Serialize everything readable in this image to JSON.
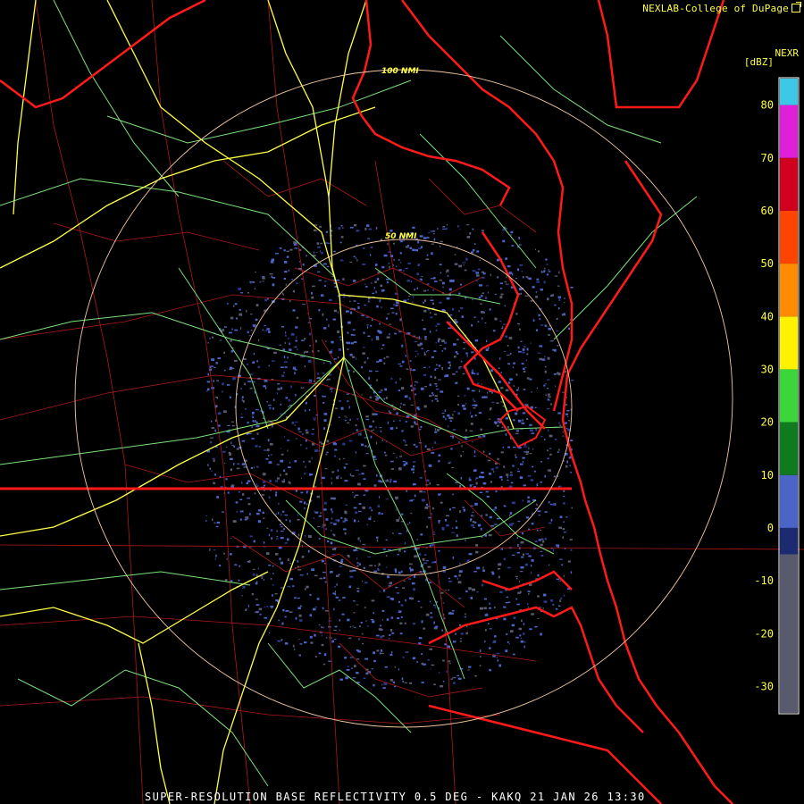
{
  "header": {
    "credit": "NEXLAB-College of DuPage",
    "product": "NEXR",
    "units": "[dBZ]"
  },
  "footer": {
    "caption": "SUPER-RESOLUTION BASE REFLECTIVITY 0.5 DEG - KAKQ 21 JAN 26 13:30"
  },
  "range_rings": {
    "inner_label": "50 NMI",
    "outer_label": "100 NMI"
  },
  "legend": {
    "ticks": [
      "80",
      "70",
      "60",
      "50",
      "40",
      "30",
      "20",
      "10",
      "0",
      "-10",
      "-20",
      "-30"
    ],
    "scale_min": -35,
    "scale_max": 85,
    "bands": [
      {
        "from": -35,
        "to": -5,
        "color": "#5a5a6e"
      },
      {
        "from": -5,
        "to": 0,
        "color": "#1c2a72"
      },
      {
        "from": 0,
        "to": 10,
        "color": "#4a64c8"
      },
      {
        "from": 10,
        "to": 20,
        "color": "#0f7a1e"
      },
      {
        "from": 20,
        "to": 30,
        "color": "#3ad63a"
      },
      {
        "from": 30,
        "to": 40,
        "color": "#fff200"
      },
      {
        "from": 40,
        "to": 50,
        "color": "#ff8c00"
      },
      {
        "from": 50,
        "to": 60,
        "color": "#ff4400"
      },
      {
        "from": 60,
        "to": 70,
        "color": "#d0001e"
      },
      {
        "from": 70,
        "to": 80,
        "color": "#e020d8"
      },
      {
        "from": 80,
        "to": 85,
        "color": "#3ec8e8"
      }
    ]
  },
  "colors": {
    "background": "#000000",
    "coast_state": "#ff1a1a",
    "county": "#b01818",
    "highway": "#ffff44",
    "road": "#7ce07c",
    "echo": "#4a64c8",
    "text": "#ffff44"
  }
}
